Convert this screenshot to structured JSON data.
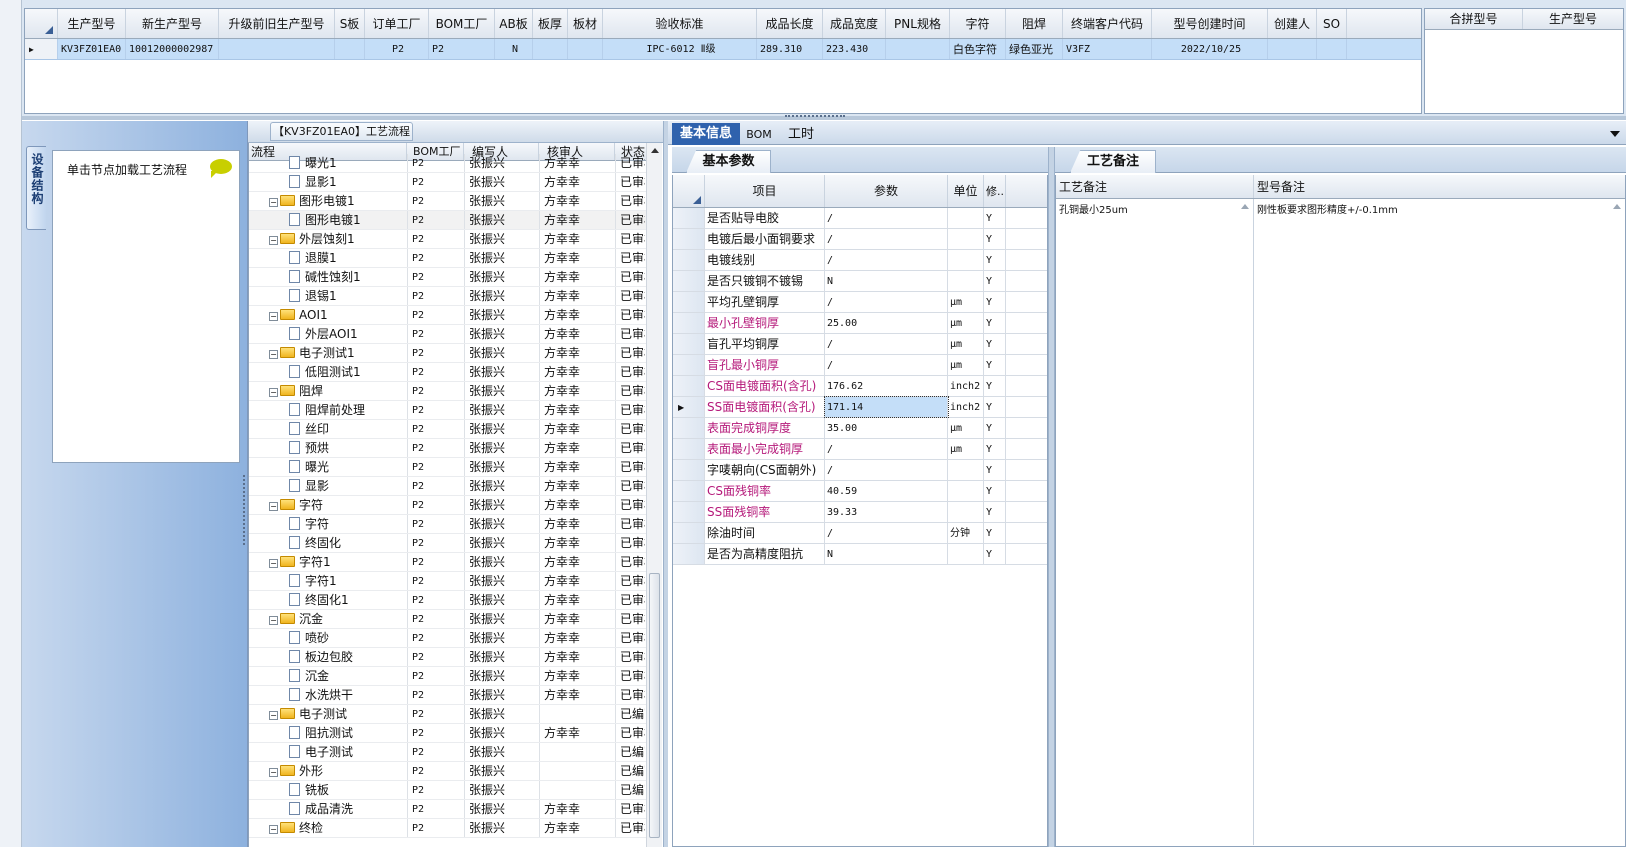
{
  "top_grid": {
    "columns": [
      "生产型号",
      "新生产型号",
      "升级前旧生产型号",
      "S板",
      "订单工厂",
      "BOM工厂",
      "AB板",
      "板厚",
      "板材",
      "验收标准",
      "成品长度",
      "成品宽度",
      "PNL规格",
      "字符",
      "阻焊",
      "终端客户代码",
      "型号创建时间",
      "创建人",
      "SO"
    ],
    "row": [
      "KV3FZ01EA0",
      "10012000002987",
      "",
      "",
      "P2",
      "P2",
      "N",
      "",
      "",
      "IPC-6012 Ⅱ级",
      "289.310",
      "223.430",
      "",
      "白色字符",
      "绿色亚光",
      "V3FZ",
      "2022/10/25",
      "",
      ""
    ],
    "merge_columns": [
      "合拼型号",
      "生产型号"
    ]
  },
  "left_panel": {
    "vertical_tab": "设备结构",
    "hint": "单击节点加载工艺流程"
  },
  "tree_panel": {
    "title": "【KV3FZ01EA0】工艺流程",
    "columns": [
      "流程",
      "BOM工厂",
      "编写人",
      "核审人",
      "状态"
    ],
    "rows": [
      {
        "level": 2,
        "icon": "doc",
        "name": "曝光1",
        "bom": "P2",
        "writer": "张振兴",
        "reviewer": "方幸幸",
        "status": "已审核"
      },
      {
        "level": 2,
        "icon": "doc",
        "name": "显影1",
        "bom": "P2",
        "writer": "张振兴",
        "reviewer": "方幸幸",
        "status": "已审核"
      },
      {
        "level": 1,
        "icon": "folder",
        "name": "图形电镀1",
        "bom": "P2",
        "writer": "张振兴",
        "reviewer": "方幸幸",
        "status": "已审核"
      },
      {
        "level": 2,
        "icon": "doc",
        "name": "图形电镀1",
        "bom": "P2",
        "writer": "张振兴",
        "reviewer": "方幸幸",
        "status": "已审核",
        "selected": true
      },
      {
        "level": 1,
        "icon": "folder",
        "name": "外层蚀刻1",
        "bom": "P2",
        "writer": "张振兴",
        "reviewer": "方幸幸",
        "status": "已审核"
      },
      {
        "level": 2,
        "icon": "doc",
        "name": "退膜1",
        "bom": "P2",
        "writer": "张振兴",
        "reviewer": "方幸幸",
        "status": "已审核"
      },
      {
        "level": 2,
        "icon": "doc",
        "name": "碱性蚀刻1",
        "bom": "P2",
        "writer": "张振兴",
        "reviewer": "方幸幸",
        "status": "已审核"
      },
      {
        "level": 2,
        "icon": "doc",
        "name": "退锡1",
        "bom": "P2",
        "writer": "张振兴",
        "reviewer": "方幸幸",
        "status": "已审核"
      },
      {
        "level": 1,
        "icon": "folder",
        "name": "AOI1",
        "bom": "P2",
        "writer": "张振兴",
        "reviewer": "方幸幸",
        "status": "已审核"
      },
      {
        "level": 2,
        "icon": "doc",
        "name": "外层AOI1",
        "bom": "P2",
        "writer": "张振兴",
        "reviewer": "方幸幸",
        "status": "已审核"
      },
      {
        "level": 1,
        "icon": "folder",
        "name": "电子测试1",
        "bom": "P2",
        "writer": "张振兴",
        "reviewer": "方幸幸",
        "status": "已审核"
      },
      {
        "level": 2,
        "icon": "doc",
        "name": "低阻测试1",
        "bom": "P2",
        "writer": "张振兴",
        "reviewer": "方幸幸",
        "status": "已审核"
      },
      {
        "level": 1,
        "icon": "folder",
        "name": "阻焊",
        "bom": "P2",
        "writer": "张振兴",
        "reviewer": "方幸幸",
        "status": "已审核"
      },
      {
        "level": 2,
        "icon": "doc",
        "name": "阻焊前处理",
        "bom": "P2",
        "writer": "张振兴",
        "reviewer": "方幸幸",
        "status": "已审核"
      },
      {
        "level": 2,
        "icon": "doc",
        "name": "丝印",
        "bom": "P2",
        "writer": "张振兴",
        "reviewer": "方幸幸",
        "status": "已审核"
      },
      {
        "level": 2,
        "icon": "doc",
        "name": "预烘",
        "bom": "P2",
        "writer": "张振兴",
        "reviewer": "方幸幸",
        "status": "已审核"
      },
      {
        "level": 2,
        "icon": "doc",
        "name": "曝光",
        "bom": "P2",
        "writer": "张振兴",
        "reviewer": "方幸幸",
        "status": "已审核"
      },
      {
        "level": 2,
        "icon": "doc",
        "name": "显影",
        "bom": "P2",
        "writer": "张振兴",
        "reviewer": "方幸幸",
        "status": "已审核"
      },
      {
        "level": 1,
        "icon": "folder",
        "name": "字符",
        "bom": "P2",
        "writer": "张振兴",
        "reviewer": "方幸幸",
        "status": "已审核"
      },
      {
        "level": 2,
        "icon": "doc",
        "name": "字符",
        "bom": "P2",
        "writer": "张振兴",
        "reviewer": "方幸幸",
        "status": "已审核"
      },
      {
        "level": 2,
        "icon": "doc",
        "name": "终固化",
        "bom": "P2",
        "writer": "张振兴",
        "reviewer": "方幸幸",
        "status": "已审核"
      },
      {
        "level": 1,
        "icon": "folder",
        "name": "字符1",
        "bom": "P2",
        "writer": "张振兴",
        "reviewer": "方幸幸",
        "status": "已审核"
      },
      {
        "level": 2,
        "icon": "doc",
        "name": "字符1",
        "bom": "P2",
        "writer": "张振兴",
        "reviewer": "方幸幸",
        "status": "已审核"
      },
      {
        "level": 2,
        "icon": "doc",
        "name": "终固化1",
        "bom": "P2",
        "writer": "张振兴",
        "reviewer": "方幸幸",
        "status": "已审核"
      },
      {
        "level": 1,
        "icon": "folder",
        "name": "沉金",
        "bom": "P2",
        "writer": "张振兴",
        "reviewer": "方幸幸",
        "status": "已审核"
      },
      {
        "level": 2,
        "icon": "doc",
        "name": "喷砂",
        "bom": "P2",
        "writer": "张振兴",
        "reviewer": "方幸幸",
        "status": "已审核"
      },
      {
        "level": 2,
        "icon": "doc",
        "name": "板边包胶",
        "bom": "P2",
        "writer": "张振兴",
        "reviewer": "方幸幸",
        "status": "已审核"
      },
      {
        "level": 2,
        "icon": "doc",
        "name": "沉金",
        "bom": "P2",
        "writer": "张振兴",
        "reviewer": "方幸幸",
        "status": "已审核"
      },
      {
        "level": 2,
        "icon": "doc",
        "name": "水洗烘干",
        "bom": "P2",
        "writer": "张振兴",
        "reviewer": "方幸幸",
        "status": "已审核"
      },
      {
        "level": 1,
        "icon": "folder",
        "name": "电子测试",
        "bom": "P2",
        "writer": "张振兴",
        "reviewer": "",
        "status": "已编写"
      },
      {
        "level": 2,
        "icon": "doc",
        "name": "阻抗测试",
        "bom": "P2",
        "writer": "张振兴",
        "reviewer": "方幸幸",
        "status": "已审核"
      },
      {
        "level": 2,
        "icon": "doc",
        "name": "电子测试",
        "bom": "P2",
        "writer": "张振兴",
        "reviewer": "",
        "status": "已编写"
      },
      {
        "level": 1,
        "icon": "folder",
        "name": "外形",
        "bom": "P2",
        "writer": "张振兴",
        "reviewer": "",
        "status": "已编写"
      },
      {
        "level": 2,
        "icon": "doc",
        "name": "铣板",
        "bom": "P2",
        "writer": "张振兴",
        "reviewer": "",
        "status": "已编写"
      },
      {
        "level": 2,
        "icon": "doc",
        "name": "成品清洗",
        "bom": "P2",
        "writer": "张振兴",
        "reviewer": "方幸幸",
        "status": "已审核"
      },
      {
        "level": 1,
        "icon": "folder",
        "name": "终检",
        "bom": "P2",
        "writer": "张振兴",
        "reviewer": "方幸幸",
        "status": "已审核"
      }
    ]
  },
  "right_panel": {
    "tabs": [
      "基本信息",
      "BOM",
      "工时"
    ],
    "basic_params": {
      "tab": "基本参数",
      "columns": [
        "项目",
        "参数",
        "单位",
        "修..."
      ],
      "rows": [
        {
          "item": "是否贴导电胶",
          "param": "/",
          "unit": "",
          "mod": "Y",
          "pink": false
        },
        {
          "item": "电镀后最小面铜要求",
          "param": "/",
          "unit": "",
          "mod": "Y",
          "pink": false
        },
        {
          "item": "电镀线别",
          "param": "/",
          "unit": "",
          "mod": "Y",
          "pink": false
        },
        {
          "item": "是否只镀铜不镀锡",
          "param": "N",
          "unit": "",
          "mod": "Y",
          "pink": false
        },
        {
          "item": "平均孔壁铜厚",
          "param": "/",
          "unit": "μm",
          "mod": "Y",
          "pink": false
        },
        {
          "item": "最小孔壁铜厚",
          "param": "25.00",
          "unit": "μm",
          "mod": "Y",
          "pink": true
        },
        {
          "item": "盲孔平均铜厚",
          "param": "/",
          "unit": "μm",
          "mod": "Y",
          "pink": false
        },
        {
          "item": "盲孔最小铜厚",
          "param": "/",
          "unit": "μm",
          "mod": "Y",
          "pink": true
        },
        {
          "item": "CS面电镀面积(含孔)",
          "param": "176.62",
          "unit": "inch2",
          "mod": "Y",
          "pink": true
        },
        {
          "item": "SS面电镀面积(含孔)",
          "param": "171.14",
          "unit": "inch2",
          "mod": "Y",
          "pink": true,
          "selected": true
        },
        {
          "item": "表面完成铜厚度",
          "param": "35.00",
          "unit": "μm",
          "mod": "Y",
          "pink": true
        },
        {
          "item": "表面最小完成铜厚",
          "param": "/",
          "unit": "μm",
          "mod": "Y",
          "pink": true
        },
        {
          "item": "字唛朝向(CS面朝外)",
          "param": "/",
          "unit": "",
          "mod": "Y",
          "pink": false
        },
        {
          "item": "CS面残铜率",
          "param": "40.59",
          "unit": "",
          "mod": "Y",
          "pink": true
        },
        {
          "item": "SS面残铜率",
          "param": "39.33",
          "unit": "",
          "mod": "Y",
          "pink": true
        },
        {
          "item": "除油时间",
          "param": "/",
          "unit": "分钟",
          "mod": "Y",
          "pink": false
        },
        {
          "item": "是否为高精度阻抗",
          "param": "N",
          "unit": "",
          "mod": "Y",
          "pink": false
        }
      ]
    },
    "process_notes": {
      "tab": "工艺备注",
      "col1": "工艺备注",
      "col2": "型号备注",
      "val1": "孔铜最小25um",
      "val2": "刚性板要求图形精度+/-0.1mm"
    }
  },
  "colors": {
    "pink_text": "#b5197a",
    "accent_tab": "#2f62ad",
    "selected_row": "#c4def8"
  }
}
